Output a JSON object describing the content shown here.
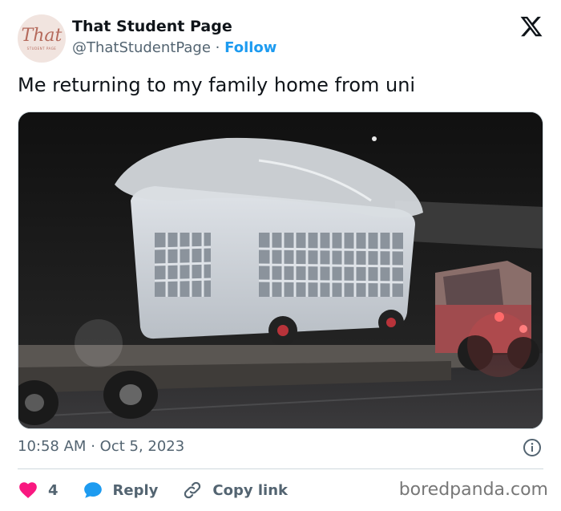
{
  "author": {
    "avatar_text": "That",
    "avatar_sub": "STUDENT PAGE",
    "name": "That Student Page",
    "handle": "@ThatStudentPage",
    "separator": "·",
    "follow_label": "Follow"
  },
  "tweet": {
    "text": "Me returning to my family home from uni",
    "media_icon": "laundry-basket-on-truck-photo"
  },
  "meta": {
    "time": "10:58 AM",
    "separator": "·",
    "date": "Oct 5, 2023"
  },
  "actions": {
    "like_count": "4",
    "reply_label": "Reply",
    "copy_label": "Copy link"
  },
  "watermark": "boredpanda.com",
  "colors": {
    "link": "#1d9bf0",
    "heart": "#f91880",
    "muted": "#536471",
    "text": "#0f1419"
  }
}
